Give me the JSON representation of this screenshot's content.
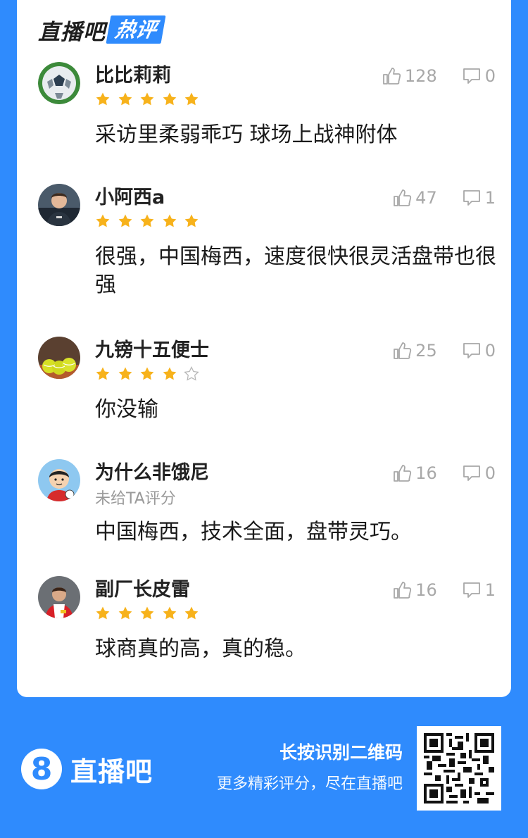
{
  "header": {
    "brand": "直播吧",
    "badge": "热评"
  },
  "comments": [
    {
      "user": "比比莉莉",
      "rating": 5,
      "rating_text": "",
      "likes": "128",
      "replies": "0",
      "text": "采访里柔弱乖巧 球场上战神附体"
    },
    {
      "user": "小阿西a",
      "rating": 5,
      "rating_text": "",
      "likes": "47",
      "replies": "1",
      "text": "很强，中国梅西，速度很快很灵活盘带也很强"
    },
    {
      "user": "九镑十五便士",
      "rating": 4,
      "rating_text": "",
      "likes": "25",
      "replies": "0",
      "text": "你没输"
    },
    {
      "user": "为什么非饿尼",
      "rating": 0,
      "rating_text": "未给TA评分",
      "likes": "16",
      "replies": "0",
      "text": "中国梅西，技术全面，盘带灵巧。"
    },
    {
      "user": "副厂长皮雷",
      "rating": 5,
      "rating_text": "",
      "likes": "16",
      "replies": "1",
      "text": "球商真的高，真的稳。"
    }
  ],
  "footer": {
    "logo_digit": "8",
    "brand": "直播吧",
    "promo_line1": "长按识别二维码",
    "promo_line2": "更多精彩评分，尽在直播吧"
  },
  "colors": {
    "accent": "#2f8bfd",
    "star": "#f7b21b",
    "star_empty": "#b8b8b8",
    "meta": "#a8a8a8"
  },
  "icons": {
    "like": "thumbs-up-icon",
    "reply": "comment-bubble-icon",
    "star": "star-icon"
  }
}
